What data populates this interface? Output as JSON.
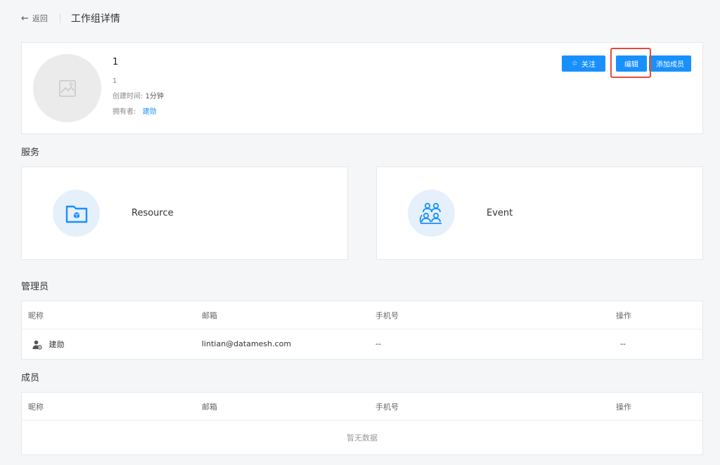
{
  "header": {
    "back_label": "返回",
    "title": "工作组详情"
  },
  "profile": {
    "name": "1",
    "description": "1",
    "created_label": "创建时间:",
    "created_value": "1分钟",
    "owner_label": "拥有者:",
    "owner_value": "建勋",
    "buttons": {
      "follow": "关注",
      "edit": "编辑",
      "add_member": "添加成员"
    }
  },
  "services": {
    "title": "服务",
    "items": [
      {
        "label": "Resource",
        "icon": "folder-cube-icon"
      },
      {
        "label": "Event",
        "icon": "group-users-icon"
      }
    ]
  },
  "admins": {
    "title": "管理员",
    "columns": [
      "昵称",
      "邮箱",
      "手机号",
      "操作"
    ],
    "rows": [
      {
        "nickname": "建勋",
        "email": "lintian@datamesh.com",
        "phone": "--",
        "action": "--"
      }
    ]
  },
  "members": {
    "title": "成员",
    "columns": [
      "昵称",
      "邮箱",
      "手机号",
      "操作"
    ],
    "empty_text": "暂无数据"
  },
  "colors": {
    "primary": "#1890ff",
    "highlight": "#e54a3c",
    "background": "#f5f6f8"
  }
}
